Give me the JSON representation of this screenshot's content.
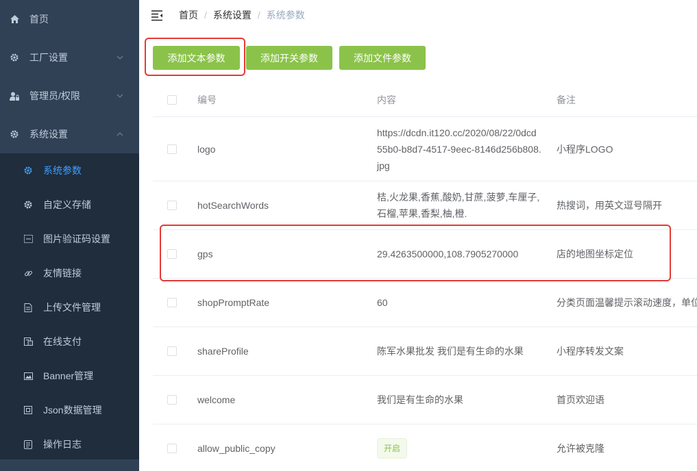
{
  "sidebar": {
    "items": [
      {
        "label": "首页",
        "icon": "home-icon",
        "has_arrow": false
      },
      {
        "label": "工厂设置",
        "icon": "gear-icon",
        "has_arrow": true
      },
      {
        "label": "管理员/权限",
        "icon": "user-lock-icon",
        "has_arrow": true
      },
      {
        "label": "系统设置",
        "icon": "gear-icon",
        "has_arrow": true,
        "expanded": true
      }
    ],
    "submenu": [
      {
        "label": "系统参数",
        "icon": "gear-icon",
        "active": true
      },
      {
        "label": "自定义存储",
        "icon": "gear-icon"
      },
      {
        "label": "图片验证码设置",
        "icon": "captcha-icon"
      },
      {
        "label": "友情链接",
        "icon": "link-icon"
      },
      {
        "label": "上传文件管理",
        "icon": "upload-file-icon"
      },
      {
        "label": "在线支付",
        "icon": "payment-icon"
      },
      {
        "label": "Banner管理",
        "icon": "image-icon"
      },
      {
        "label": "Json数据管理",
        "icon": "json-icon"
      },
      {
        "label": "操作日志",
        "icon": "log-icon"
      }
    ]
  },
  "breadcrumb": [
    "首页",
    "系统设置",
    "系统参数"
  ],
  "toolbar": {
    "add_text": "添加文本参数",
    "add_switch": "添加开关参数",
    "add_file": "添加文件参数"
  },
  "table": {
    "headers": {
      "id": "编号",
      "content": "内容",
      "remark": "备注"
    },
    "rows": [
      {
        "id": "logo",
        "content": "https://dcdn.it120.cc/2020/08/22/0dcd55b0-b8d7-4517-9eec-8146d256b808.jpg",
        "remark": "小程序LOGO"
      },
      {
        "id": "hotSearchWords",
        "content": "桔,火龙果,香蕉,酸奶,甘蔗,菠萝,车厘子,石榴,苹果,香梨,柚,橙.",
        "remark": "热搜词，用英文逗号隔开"
      },
      {
        "id": "gps",
        "content": "29.4263500000,108.7905270000",
        "remark": "店的地图坐标定位"
      },
      {
        "id": "shopPromptRate",
        "content": "60",
        "remark": "分类页面温馨提示滚动速度，单位"
      },
      {
        "id": "shareProfile",
        "content": "陈军水果批发 我们是有生命的水果",
        "remark": "小程序转发文案"
      },
      {
        "id": "welcome",
        "content": "我们是有生命的水果",
        "remark": "首页欢迎语"
      },
      {
        "id": "allow_public_copy",
        "content": "开启",
        "content_is_tag": true,
        "remark": "允许被克隆"
      }
    ]
  },
  "colors": {
    "sidebar_bg": "#304156",
    "submenu_bg": "#1f2d3d",
    "active": "#409eff",
    "button": "#8bc34a",
    "highlight": "#e53935"
  }
}
